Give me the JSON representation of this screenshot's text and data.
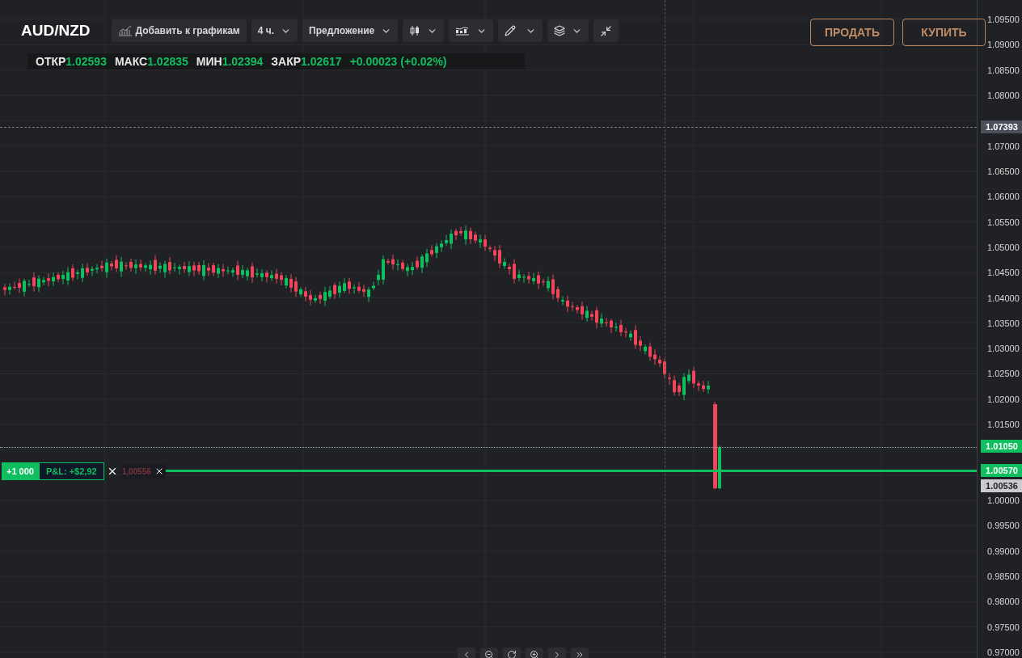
{
  "symbol": "AUD/NZD",
  "toolbar": {
    "add_to_charts": "Добавить к графикам",
    "timeframe": "4 ч.",
    "price_type": "Предложение"
  },
  "ohlc": [
    {
      "label": "ОТКР",
      "value": "1.02593"
    },
    {
      "label": "МАКС",
      "value": "1.02835"
    },
    {
      "label": "МИН",
      "value": "1.02394"
    },
    {
      "label": "ЗАКР",
      "value": "1.02617"
    }
  ],
  "change": "+0.00023 (+0.02%)",
  "actions": {
    "sell": "ПРОДАТЬ",
    "buy": "КУПИТЬ"
  },
  "price_axis": [
    "1.09500",
    "1.09000",
    "1.08500",
    "1.08000",
    "1.07000",
    "1.06500",
    "1.06000",
    "1.05500",
    "1.05000",
    "1.04500",
    "1.04000",
    "1.03500",
    "1.03000",
    "1.02500",
    "1.02000",
    "1.01500",
    "1.00000",
    "0.99500",
    "0.99000",
    "0.98500",
    "0.98000",
    "0.97500",
    "0.97000"
  ],
  "price_tags": [
    {
      "kind": "crosshair",
      "value": "1.07393"
    },
    {
      "kind": "ask",
      "value": "1.01050"
    },
    {
      "kind": "position",
      "value": "1.00570"
    },
    {
      "kind": "bid",
      "value": "1.00536"
    }
  ],
  "position": {
    "size": "+1 000",
    "pnl": "P&L: +$2,92",
    "order_price": "1,00556"
  }
}
